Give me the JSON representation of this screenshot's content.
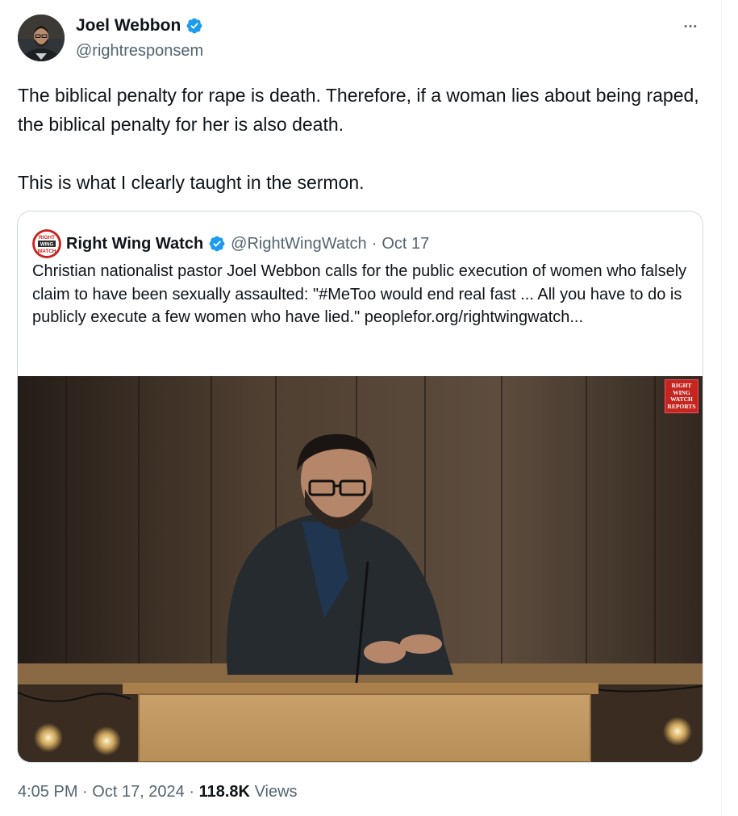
{
  "tweet": {
    "author": {
      "name": "Joel Webbon",
      "handle": "@rightresponsem",
      "verified": true
    },
    "more_glyph": "•••",
    "paragraphs": [
      "The biblical penalty for rape is death. Therefore, if a woman lies about being raped, the biblical penalty for her is also death.",
      "This is what I clearly taught in the sermon."
    ],
    "quote": {
      "author": {
        "name": "Right Wing Watch",
        "handle": "@RightWingWatch",
        "verified": true
      },
      "separator": "·",
      "date": "Oct 17",
      "logo_text": [
        "RIGHT",
        "WING",
        "WATCH"
      ],
      "text": "Christian nationalist pastor Joel Webbon calls for the public execution of women who falsely claim to have been sexually assaulted: \"#MeToo would end real fast ... All you have to do is publicly execute a few women who have lied.\" peoplefor.org/rightwingwatch...",
      "video_badge_lines": [
        "RIGHT",
        "WING",
        "WATCH",
        "REPORTS"
      ]
    },
    "meta": {
      "time": "4:05 PM",
      "sep1": "·",
      "date": "Oct 17, 2024",
      "sep2": "·",
      "views_count": "118.8K",
      "views_label": "Views"
    }
  },
  "colors": {
    "text": "#0f1419",
    "secondary": "#536471",
    "verified": "#1d9bf0",
    "border": "#cfd9de",
    "badge_red": "#c6241e"
  },
  "icons": {
    "verified": "verified-badge-icon",
    "more": "more-horizontal-icon"
  }
}
